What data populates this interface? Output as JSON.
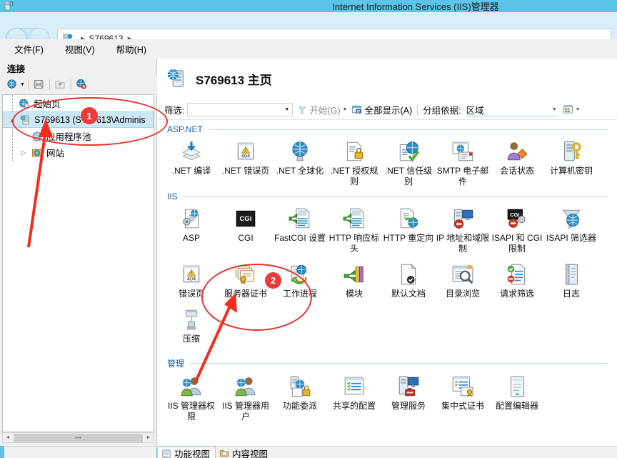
{
  "window": {
    "title": "Internet Information Services (IIS)管理器",
    "title_icon": "server-icon"
  },
  "navbar": {
    "back_icon": "back-arrow-icon",
    "forward_icon": "forward-arrow-icon",
    "breadcrumb_icon": "server-icon",
    "breadcrumb_item": "S769613",
    "separator": "▸"
  },
  "menu": {
    "items": [
      {
        "label": "文件(F)"
      },
      {
        "label": "视图(V)"
      },
      {
        "label": "帮助(H)"
      }
    ]
  },
  "connections": {
    "header": "连接",
    "toolbar": [
      {
        "name": "connect-to-icon",
        "glyph": "globe"
      },
      {
        "name": "save-icon",
        "glyph": "disk"
      },
      {
        "name": "up-one-level-icon",
        "glyph": "up"
      },
      {
        "name": "disconnect-icon",
        "glyph": "globe-x"
      }
    ],
    "tree": [
      {
        "label": "起始页",
        "icon": "start-page-icon",
        "indent": 1,
        "expander": "",
        "selected": false
      },
      {
        "label": "S769613 (S769613\\Adminis",
        "icon": "server-icon",
        "indent": 0,
        "expander": "▲",
        "selected": true
      },
      {
        "label": "应用程序池",
        "icon": "app-pools-icon",
        "indent": 2,
        "expander": "",
        "selected": false
      },
      {
        "label": "网站",
        "icon": "sites-icon",
        "indent": 2,
        "expander": "▷",
        "selected": false
      }
    ],
    "scroll_thumb_glyph": "•••",
    "scroll_left_glyph": "◄",
    "scroll_right_glyph": "►"
  },
  "page": {
    "title": "S769613 主页",
    "title_icon": "server-home-icon"
  },
  "filterbar": {
    "filter_label": "筛选:",
    "filter_value": "",
    "filter_caret": "▼",
    "funnel_icon": "funnel-icon",
    "start_label": "开始(G)",
    "start_caret": "▼",
    "show_all_icon": "show-all-icon",
    "show_all_label": "全部显示(A)",
    "groupby_label": "分组依据:",
    "groupby_value": "区域",
    "groupby_caret": "▼",
    "viewmode_icon": "view-mode-icon",
    "viewmode_caret": "▼"
  },
  "sections": [
    {
      "title": "ASP.NET",
      "rows": [
        [
          {
            "label": ".NET 编译",
            "icon": "net-compilation-icon"
          },
          {
            "label": ".NET 错误页",
            "icon": "net-error-pages-icon"
          },
          {
            "label": ".NET 全球化",
            "icon": "net-globalization-icon"
          },
          {
            "label": ".NET 授权规则",
            "icon": "net-authorization-rules-icon"
          },
          {
            "label": ".NET 信任级别",
            "icon": "net-trust-levels-icon"
          },
          {
            "label": "SMTP 电子邮件",
            "icon": "smtp-email-icon"
          },
          {
            "label": "会话状态",
            "icon": "session-state-icon"
          },
          {
            "label": "计算机密钥",
            "icon": "machine-key-icon"
          }
        ]
      ]
    },
    {
      "title": "IIS",
      "rows": [
        [
          {
            "label": "ASP",
            "icon": "asp-icon"
          },
          {
            "label": "CGI",
            "icon": "cgi-icon"
          },
          {
            "label": "FastCGI 设置",
            "icon": "fastcgi-settings-icon"
          },
          {
            "label": "HTTP 响应标头",
            "icon": "http-response-headers-icon"
          },
          {
            "label": "HTTP 重定向",
            "icon": "http-redirect-icon"
          },
          {
            "label": "IP 地址和域限制",
            "icon": "ip-restrictions-icon"
          },
          {
            "label": "ISAPI 和 CGI 限制",
            "icon": "isapi-cgi-restrictions-icon"
          },
          {
            "label": "ISAPI 筛选器",
            "icon": "isapi-filters-icon"
          }
        ],
        [
          {
            "label": "错误页",
            "icon": "error-pages-icon"
          },
          {
            "label": "服务器证书",
            "icon": "server-certificates-icon"
          },
          {
            "label": "工作进程",
            "icon": "worker-processes-icon"
          },
          {
            "label": "模块",
            "icon": "modules-icon"
          },
          {
            "label": "默认文档",
            "icon": "default-document-icon"
          },
          {
            "label": "目录浏览",
            "icon": "directory-browsing-icon"
          },
          {
            "label": "请求筛选",
            "icon": "request-filtering-icon"
          },
          {
            "label": "日志",
            "icon": "logging-icon"
          }
        ],
        [
          {
            "label": "压缩",
            "icon": "compression-icon"
          }
        ]
      ]
    },
    {
      "title": "管理",
      "rows": [
        [
          {
            "label": "IIS 管理器权限",
            "icon": "iis-manager-permissions-icon"
          },
          {
            "label": "IIS 管理器用户",
            "icon": "iis-manager-users-icon"
          },
          {
            "label": "功能委派",
            "icon": "feature-delegation-icon"
          },
          {
            "label": "共享的配置",
            "icon": "shared-configuration-icon"
          },
          {
            "label": "管理服务",
            "icon": "management-service-icon"
          },
          {
            "label": "集中式证书",
            "icon": "centralized-certificates-icon"
          },
          {
            "label": "配置编辑器",
            "icon": "configuration-editor-icon"
          }
        ]
      ]
    }
  ],
  "bottom_tabs": [
    {
      "label": "功能视图",
      "icon": "features-view-icon",
      "active": true
    },
    {
      "label": "内容视图",
      "icon": "content-view-icon",
      "active": false
    }
  ],
  "annotations": {
    "badges": [
      {
        "name": "step-1-badge",
        "text": "1"
      },
      {
        "name": "step-2-badge",
        "text": "2"
      }
    ],
    "color": "#e8302f"
  }
}
